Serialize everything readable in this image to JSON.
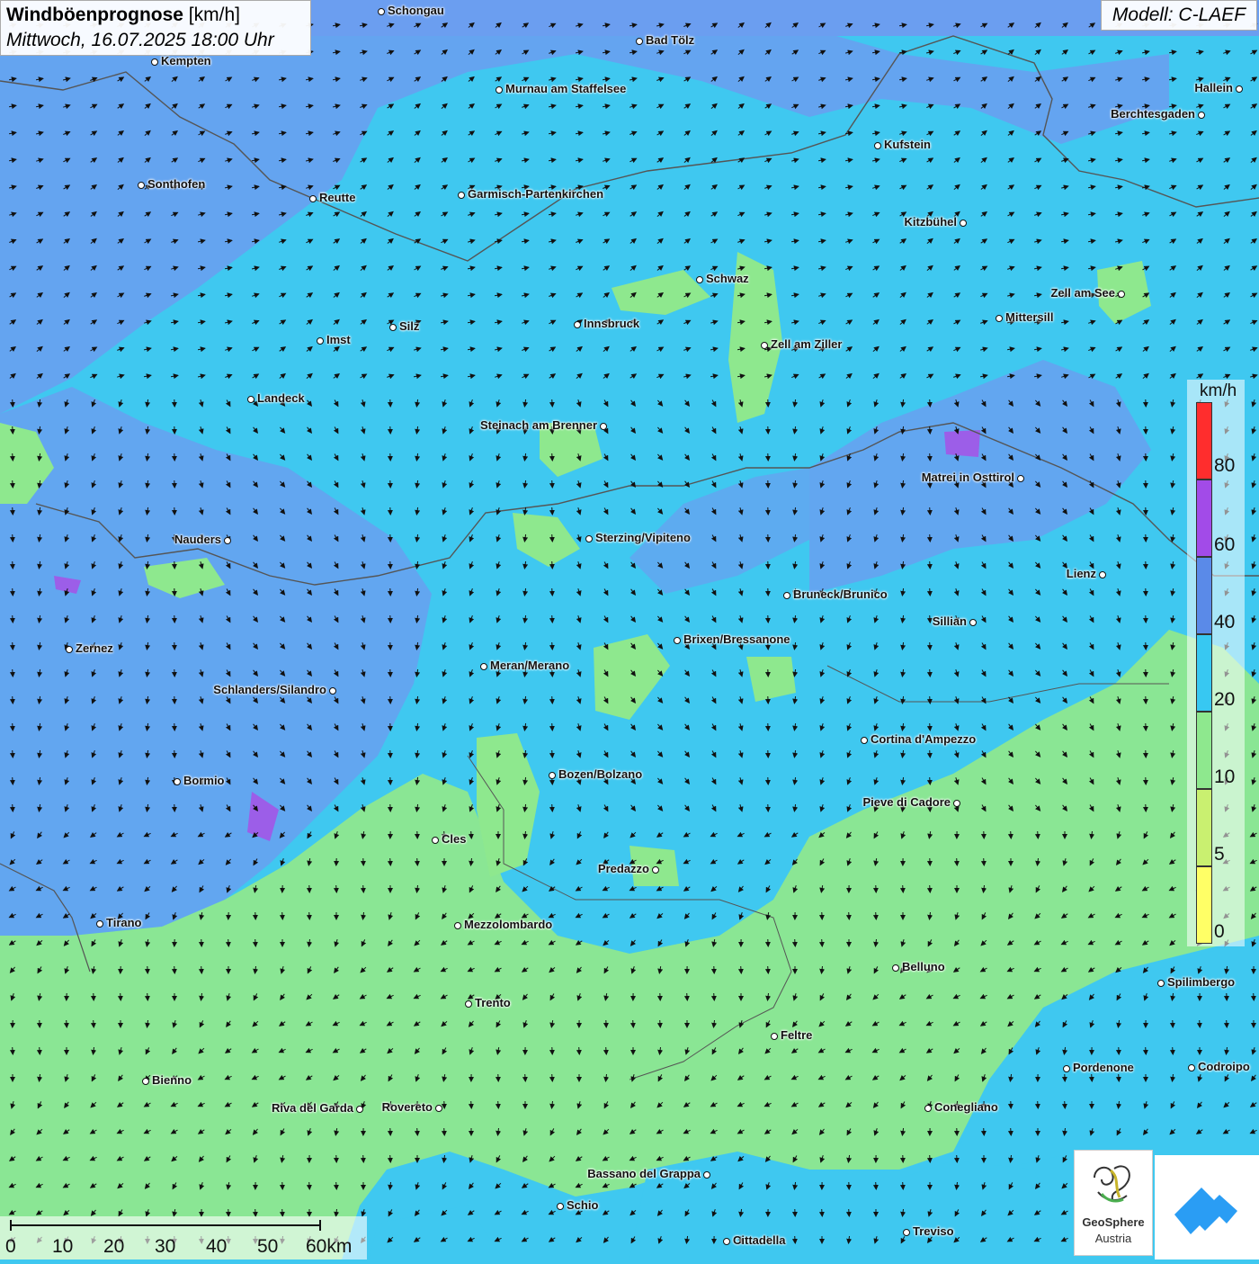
{
  "title": {
    "bold": "Windböenprognose",
    "unit": " [km/h]",
    "date": "Mittwoch, 16.07.2025 18:00 Uhr"
  },
  "model": "Modell: C-LAEF",
  "legend": {
    "unit": "km/h",
    "ticks": [
      "80",
      "60",
      "40",
      "20",
      "10",
      "5",
      "0"
    ],
    "colors": [
      "#ff2d2d",
      "#a24be8",
      "#5a8ae8",
      "#37c8f2",
      "#8ee88e",
      "#c9f070",
      "#ffff66"
    ]
  },
  "scale": {
    "labels": [
      "0",
      "10",
      "20",
      "30",
      "40",
      "50",
      "60km"
    ]
  },
  "logos": {
    "geosphere_line1": "GeoSphere",
    "geosphere_line2": "Austria"
  },
  "cities": [
    "Schongau",
    "Bad Tölz",
    "Kempten",
    "Murnau am Staffelsee",
    "Hallein",
    "Berchtesgaden",
    "Kufstein",
    "Sonthofen",
    "Reutte",
    "Garmisch-Partenkirchen",
    "Kitzbühel",
    "Schwaz",
    "Zell am See",
    "Mittersill",
    "Innsbruck",
    "Silz",
    "Imst",
    "Zell am Ziller",
    "Landeck",
    "Steinach am Brenner",
    "Matrei in Osttirol",
    "Nauders",
    "Sterzing/Vipiteno",
    "Lienz",
    "Bruneck/Brunico",
    "Sillian",
    "Zernez",
    "Brixen/Bressanone",
    "Meran/Merano",
    "Schlanders/Silandro",
    "Cortina d'Ampezzo",
    "Bozen/Bolzano",
    "Bormio",
    "Pieve di Cadore",
    "Cles",
    "Predazzo",
    "Tirano",
    "Mezzolombardo",
    "Belluno",
    "Spilimbergo",
    "Trento",
    "Feltre",
    "Pordenone",
    "Codroipo",
    "Bienno",
    "Riva del Garda",
    "Rovereto",
    "Conegliano",
    "Bassano del Grappa",
    "Schio",
    "Treviso",
    "Cittadella"
  ]
}
